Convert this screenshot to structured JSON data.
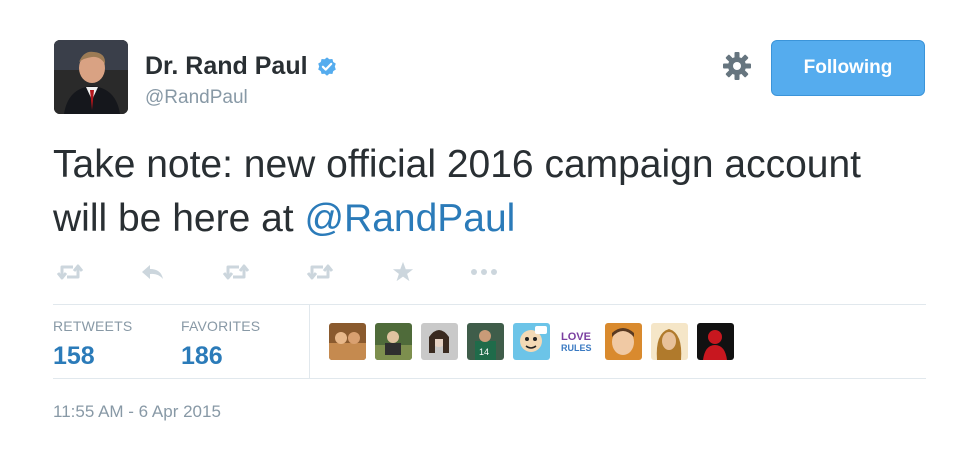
{
  "user": {
    "name": "Dr. Rand Paul",
    "handle": "@RandPaul",
    "verified": true
  },
  "follow_button": {
    "label": "Following"
  },
  "tweet": {
    "text": "Take note: new official 2016 campaign account will be here at ",
    "mention": "@RandPaul"
  },
  "actions": [
    {
      "icon": "retweet-icon"
    },
    {
      "icon": "reply-icon"
    },
    {
      "icon": "retweet-icon"
    },
    {
      "icon": "retweet-icon"
    },
    {
      "icon": "star-icon"
    },
    {
      "icon": "more-icon"
    }
  ],
  "stats": {
    "retweets_label": "RETWEETS",
    "retweets_value": "158",
    "favorites_label": "FAVORITES",
    "favorites_value": "186"
  },
  "favoriter_avatars": [
    {
      "icon": "user-avatar-1"
    },
    {
      "icon": "user-avatar-2"
    },
    {
      "icon": "user-avatar-3"
    },
    {
      "icon": "user-avatar-4"
    },
    {
      "icon": "user-avatar-5"
    },
    {
      "icon": "user-avatar-love-rules",
      "text": "LOVE RULES"
    },
    {
      "icon": "user-avatar-7"
    },
    {
      "icon": "user-avatar-8"
    },
    {
      "icon": "user-avatar-9"
    }
  ],
  "timestamp": "11:55 AM - 6 Apr 2015",
  "colors": {
    "link": "#2b7bb9",
    "button": "#55acee",
    "muted": "#8899a6",
    "text": "#292f33",
    "icon": "#ccd6dd"
  }
}
